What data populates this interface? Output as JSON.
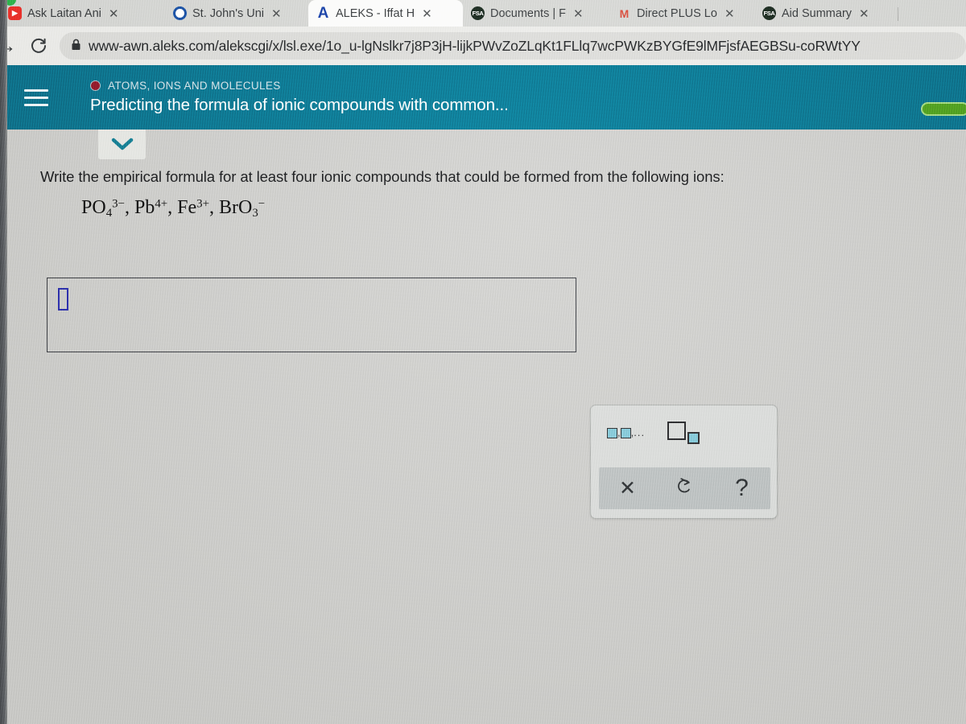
{
  "browser": {
    "tabs": [
      {
        "id": "tab-youtube",
        "label": "Ask Laitan Ani",
        "icon": "youtube-icon",
        "active": false,
        "close": "✕"
      },
      {
        "id": "tab-stjohns",
        "label": "St. John's Uni",
        "icon": "stjohns-icon",
        "active": false,
        "close": "✕"
      },
      {
        "id": "tab-aleks",
        "label": "ALEKS - Iffat H",
        "icon": "aleks-icon",
        "active": true,
        "close": "✕"
      },
      {
        "id": "tab-documents",
        "label": "Documents | F",
        "icon": "fsa-icon",
        "active": false,
        "close": "✕"
      },
      {
        "id": "tab-directplus",
        "label": "Direct PLUS Lo",
        "icon": "gmail-icon",
        "active": false,
        "close": "✕"
      },
      {
        "id": "tab-aidsummary",
        "label": "Aid Summary",
        "icon": "fsa-icon",
        "active": false,
        "close": "✕"
      }
    ],
    "nav": {
      "forward": "→",
      "reload": "⟳",
      "lock": "🔒"
    },
    "url": "www-awn.aleks.com/alekscgi/x/lsl.exe/1o_u-lgNslkr7j8P3jH-lijkPWvZoZLqKt1FLlq7wcPWKzBYGfE9lMFjsfAEGBSu-coRWtYY"
  },
  "aleks_header": {
    "topic": "ATOMS, IONS AND MOLECULES",
    "lesson_title": "Predicting the formula of ionic compounds with common...",
    "teal": "#0e6e87",
    "topic_dot_color": "#8f1a2a",
    "progress_pill_color": "#4e9b20"
  },
  "question": {
    "prompt": "Write the empirical formula for at least four ionic compounds that could be formed from the following ions:",
    "ions": [
      {
        "base": "PO",
        "sub": "4",
        "sup": "3−"
      },
      {
        "base": "Pb",
        "sub": "",
        "sup": "4+"
      },
      {
        "base": "Fe",
        "sub": "",
        "sup": "3+"
      },
      {
        "base": "BrO",
        "sub": "3",
        "sup": "−"
      }
    ],
    "ion_separator": ", "
  },
  "answer": {
    "value": "",
    "placeholder": ""
  },
  "palette": {
    "list_button": {
      "label_comma": ",",
      "label_dots": "...",
      "name": "list-of-formulas-icon"
    },
    "subscript_button": {
      "name": "subscript-icon"
    },
    "clear_button": "✕",
    "undo_button": "↺",
    "help_button": "?"
  }
}
